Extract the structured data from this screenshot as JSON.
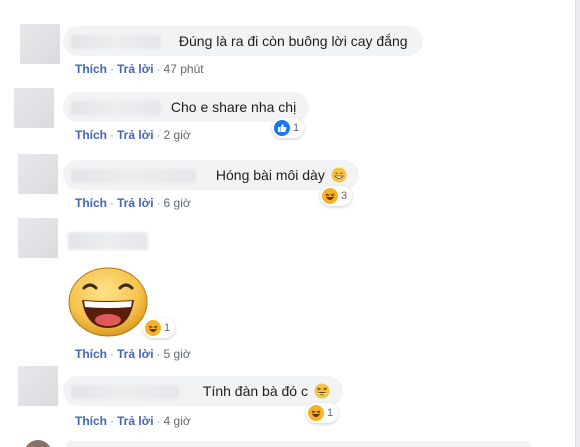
{
  "actions": {
    "like": "Thích",
    "reply": "Trả lời",
    "sep": "·"
  },
  "comments": [
    {
      "text": "Đúng là ra đi còn buông lời cay đắng",
      "time": "47 phút"
    },
    {
      "text": "Cho e share nha chị",
      "time": "2 giờ",
      "reaction": {
        "icon": "like-icon",
        "count": "1"
      }
    },
    {
      "text": "Hóng bài môi dày",
      "time": "6 giờ",
      "reaction": {
        "icon": "haha-icon",
        "count": "3"
      }
    },
    {
      "sticker": "laughing-face-sticker",
      "time": "5 giờ",
      "reaction": {
        "icon": "haha-icon",
        "count": "1"
      }
    },
    {
      "text": "Tính đàn bà đó c",
      "time": "4 giờ",
      "reaction": {
        "icon": "haha-icon",
        "count": "1"
      }
    }
  ],
  "colors": {
    "link": "#4267b2",
    "bubble": "#f2f3f5",
    "like": "#1877f2",
    "haha": "#f7b125"
  }
}
